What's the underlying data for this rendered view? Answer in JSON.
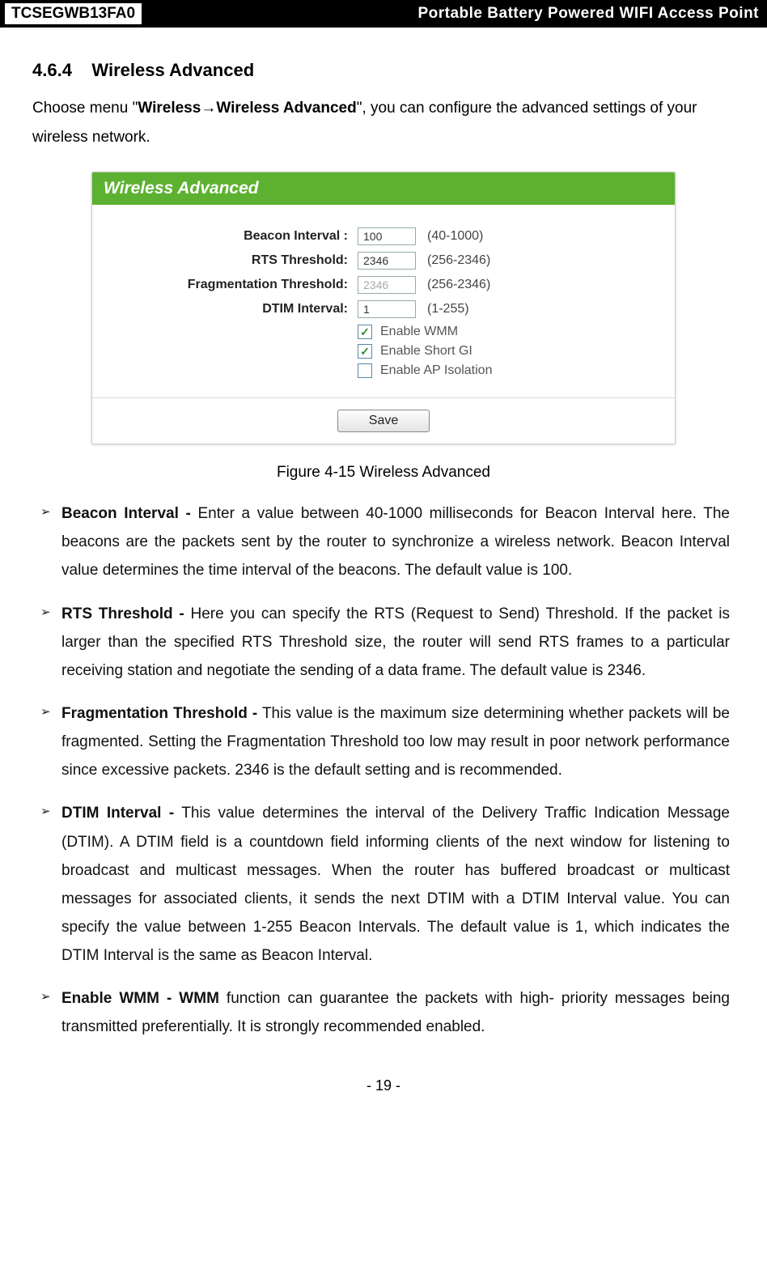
{
  "header": {
    "model": "TCSEGWB13FA0",
    "title": "Portable Battery Powered WIFI Access Point"
  },
  "section": {
    "number": "4.6.4",
    "title": "Wireless Advanced"
  },
  "intro": {
    "prefix": "Choose menu \"",
    "bold1": "Wireless",
    "arrow": "→",
    "bold2": "Wireless Advanced",
    "suffix": "\", you can configure the advanced settings of your wireless network."
  },
  "panel": {
    "title": "Wireless Advanced",
    "rows": {
      "beacon": {
        "label": "Beacon Interval :",
        "value": "100",
        "hint": "(40-1000)"
      },
      "rts": {
        "label": "RTS Threshold:",
        "value": "2346",
        "hint": "(256-2346)"
      },
      "frag": {
        "label": "Fragmentation Threshold:",
        "value": "2346",
        "hint": "(256-2346)"
      },
      "dtim": {
        "label": "DTIM Interval:",
        "value": "1",
        "hint": "(1-255)"
      }
    },
    "checks": {
      "wmm": "Enable WMM",
      "shortgi": "Enable Short GI",
      "apiso": "Enable AP Isolation"
    },
    "save": "Save"
  },
  "figure_caption": "Figure 4-15 Wireless Advanced",
  "bullets": {
    "b1_term": "Beacon Interval -",
    "b1_text": " Enter a value between 40-1000 milliseconds for Beacon Interval here. The beacons are the packets sent by the router to synchronize a wireless network. Beacon Interval value determines the time interval of the beacons. The default value is 100.",
    "b2_term": "RTS Threshold -",
    "b2_text": " Here you can specify the RTS (Request to Send) Threshold. If the packet is larger than the specified RTS Threshold size, the router will send RTS frames to a particular receiving station and negotiate the sending of a data frame. The default value is 2346.",
    "b3_term": "Fragmentation Threshold -",
    "b3_text": " This value is the maximum size determining whether packets will be fragmented. Setting the Fragmentation Threshold too low may result in poor network performance since excessive packets. 2346 is the default setting and is recommended.",
    "b4_term": "DTIM Interval -",
    "b4_text": " This value determines the interval of the Delivery Traffic Indication Message (DTIM). A DTIM field is a countdown field informing clients of the next window for listening to broadcast and multicast messages. When the router has buffered broadcast or multicast messages for associated clients, it sends the next DTIM with a DTIM Interval value. You can specify the value between 1-255 Beacon Intervals. The default value is 1, which indicates the DTIM Interval is the same as Beacon Interval.",
    "b5_term": "Enable WMM - WMM",
    "b5_text": " function can guarantee the packets with high- priority messages being transmitted preferentially. It is strongly recommended enabled."
  },
  "page_number": "- 19 -"
}
